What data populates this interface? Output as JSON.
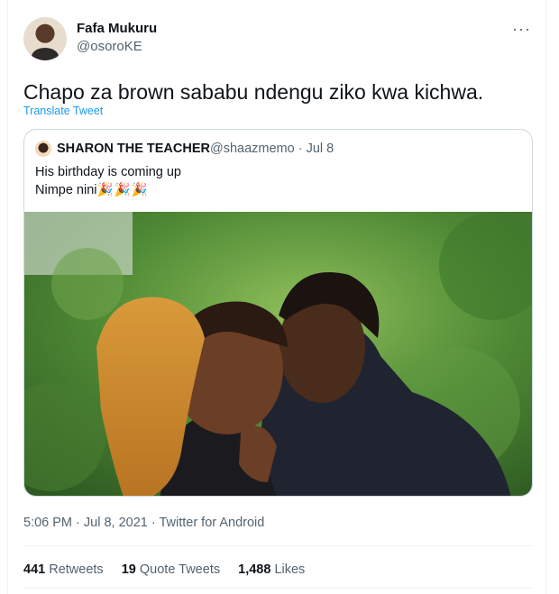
{
  "tweet": {
    "author_name": "Fafa Mukuru",
    "author_handle": "@osoroKE",
    "more_label": "···",
    "text": "Chapo za brown sababu ndengu ziko kwa kichwa.",
    "translate_label": "Translate Tweet",
    "timestamp": "5:06 PM · Jul 8, 2021 · Twitter for Android"
  },
  "quote": {
    "author_name": "SHARON THE TEACHER",
    "author_handle_date": "@shaazmemo · Jul 8",
    "line1": "His birthday is coming up",
    "line2": "Nimpe nini",
    "emoji": "🎉🎉🎉"
  },
  "stats": {
    "retweets_count": "441",
    "retweets_label": "Retweets",
    "quotes_count": "19",
    "quotes_label": "Quote Tweets",
    "likes_count": "1,488",
    "likes_label": "Likes"
  },
  "colors": {
    "link": "#1d9bf0",
    "secondary_text": "#536471",
    "border": "#cfd9de"
  }
}
